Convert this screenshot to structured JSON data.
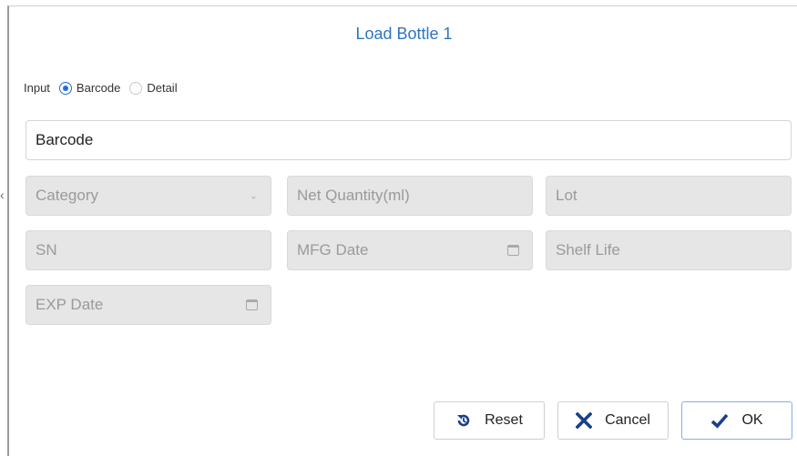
{
  "dialog": {
    "title": "Load Bottle 1",
    "input_label": "Input",
    "radio_options": [
      {
        "label": "Barcode",
        "selected": true
      },
      {
        "label": "Detail",
        "selected": false
      }
    ]
  },
  "fields": {
    "barcode_placeholder": "Barcode",
    "category_placeholder": "Category",
    "net_quantity_placeholder": "Net Quantity(ml)",
    "lot_placeholder": "Lot",
    "sn_placeholder": "SN",
    "mfg_date_placeholder": "MFG Date",
    "shelf_life_placeholder": "Shelf Life",
    "exp_date_placeholder": "EXP Date"
  },
  "buttons": {
    "reset_label": "Reset",
    "cancel_label": "Cancel",
    "ok_label": "OK"
  },
  "icons": {
    "reset": "reset-icon",
    "cancel": "x-icon",
    "ok": "checkmark-icon",
    "calendar": "calendar-icon",
    "dropdown": "chevron-down-icon"
  },
  "colors": {
    "title": "#2e74c3",
    "accent": "#1f6fd6",
    "disabled_field": "#e6e6e6"
  }
}
